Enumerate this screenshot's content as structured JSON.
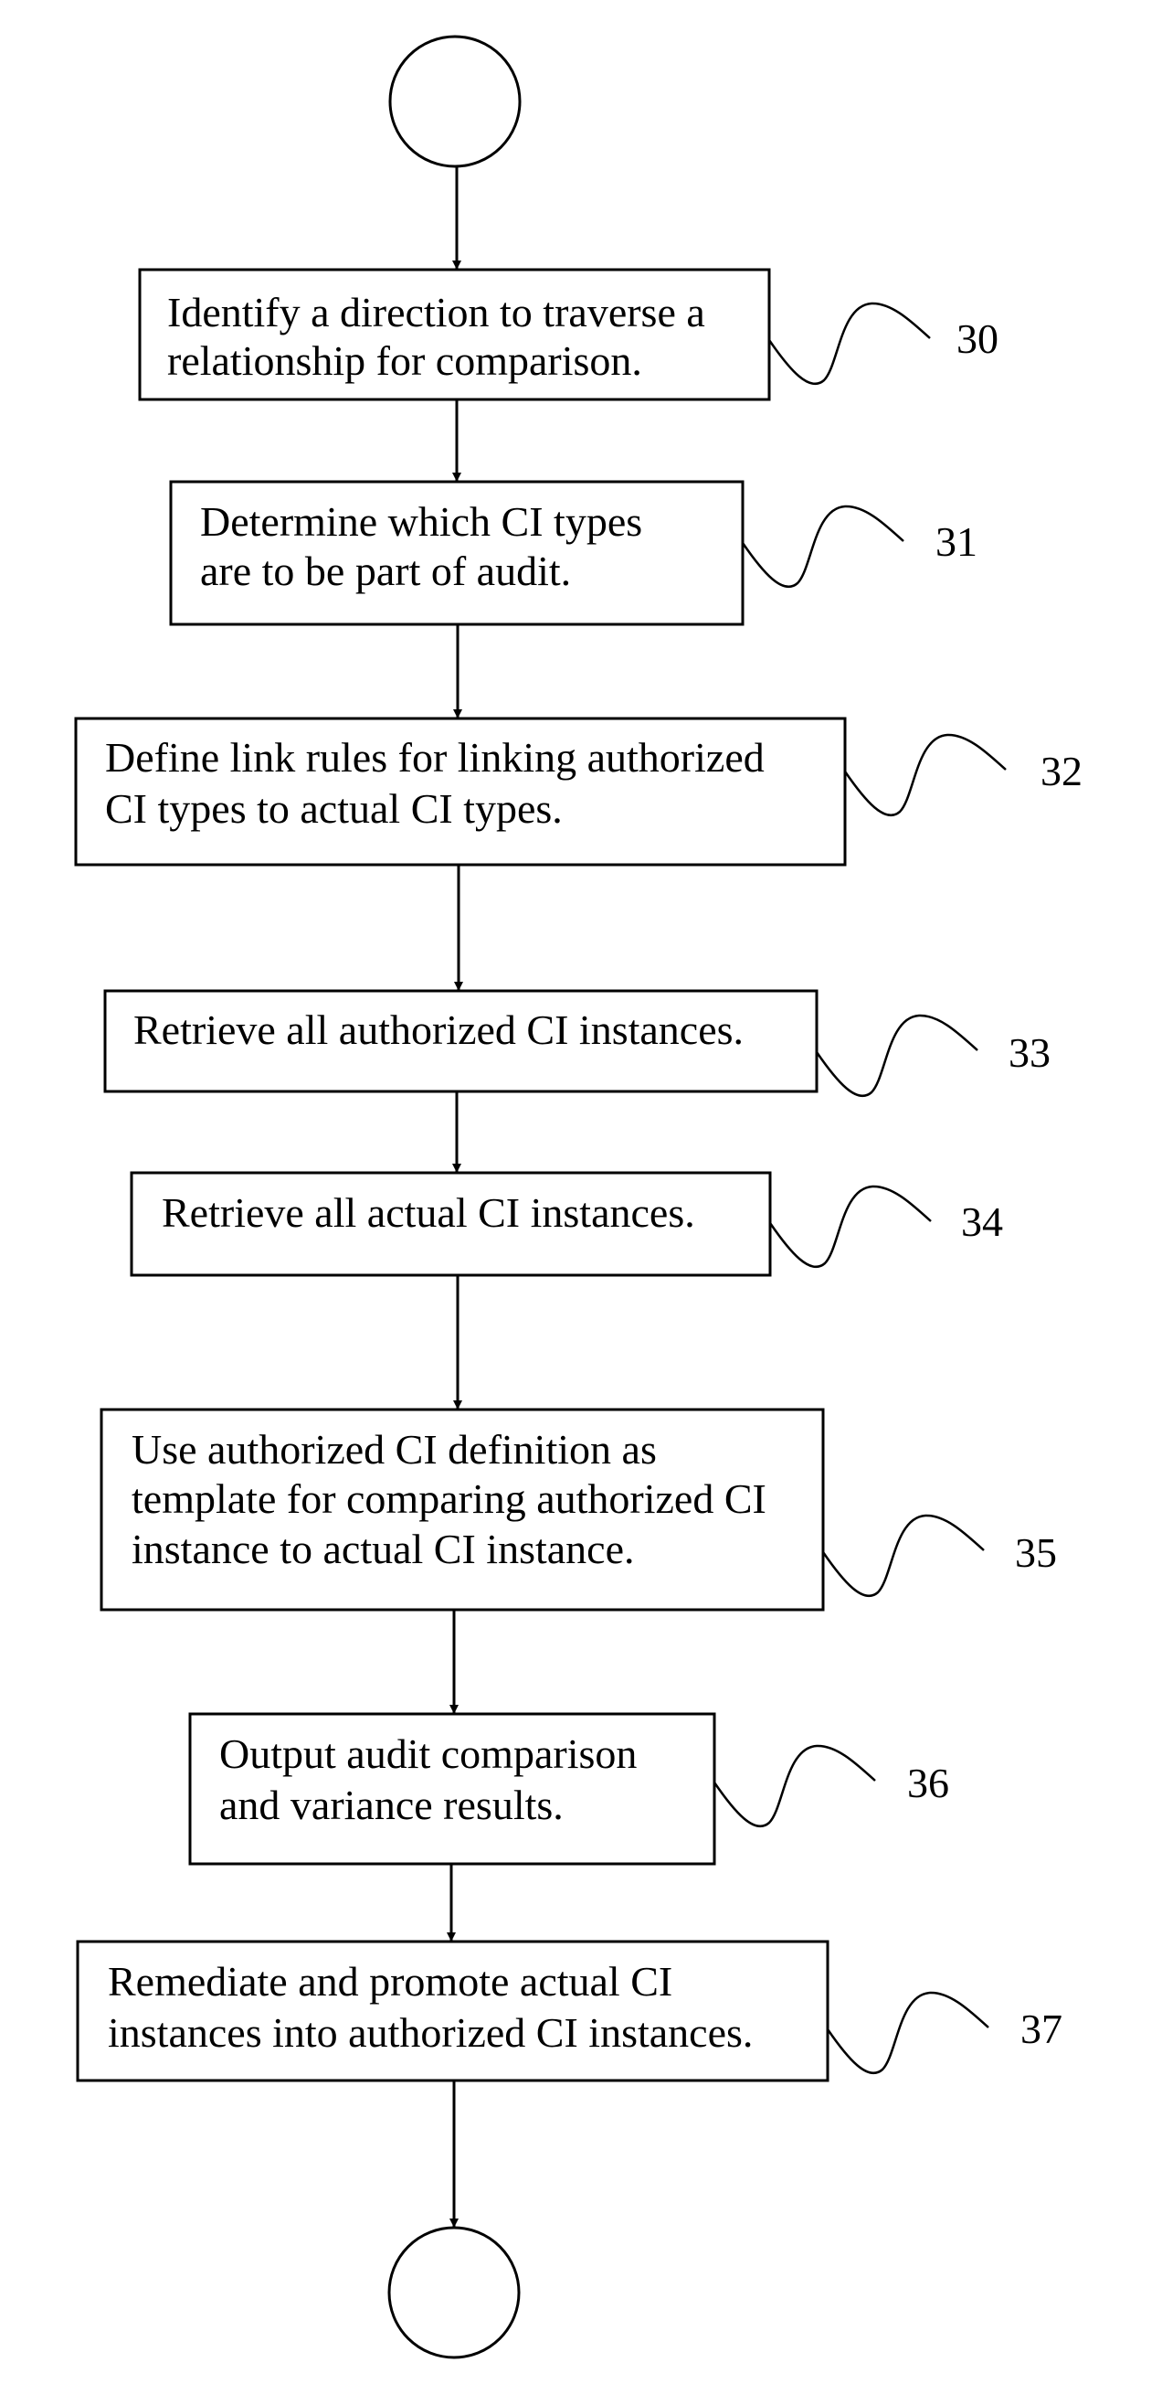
{
  "figure": {
    "type": "flowchart",
    "colors": {
      "line": "#000000",
      "background": "#ffffff"
    },
    "start_terminal": {
      "label": ""
    },
    "end_terminal": {
      "label": ""
    },
    "steps": [
      {
        "ref": "30",
        "lines": [
          "Identify a direction to traverse a",
          "relationship for comparison."
        ]
      },
      {
        "ref": "31",
        "lines": [
          "Determine which CI types",
          "are to be part of audit."
        ]
      },
      {
        "ref": "32",
        "lines": [
          "Define link rules for linking authorized",
          "CI types to actual CI types."
        ]
      },
      {
        "ref": "33",
        "lines": [
          "Retrieve all authorized CI instances."
        ]
      },
      {
        "ref": "34",
        "lines": [
          "Retrieve all actual CI instances."
        ]
      },
      {
        "ref": "35",
        "lines": [
          "Use authorized CI definition as",
          "template for comparing authorized CI",
          "instance to actual CI instance."
        ]
      },
      {
        "ref": "36",
        "lines": [
          "Output audit comparison",
          "and variance results."
        ]
      },
      {
        "ref": "37",
        "lines": [
          "Remediate and promote actual CI",
          "instances into authorized CI instances."
        ]
      }
    ]
  }
}
